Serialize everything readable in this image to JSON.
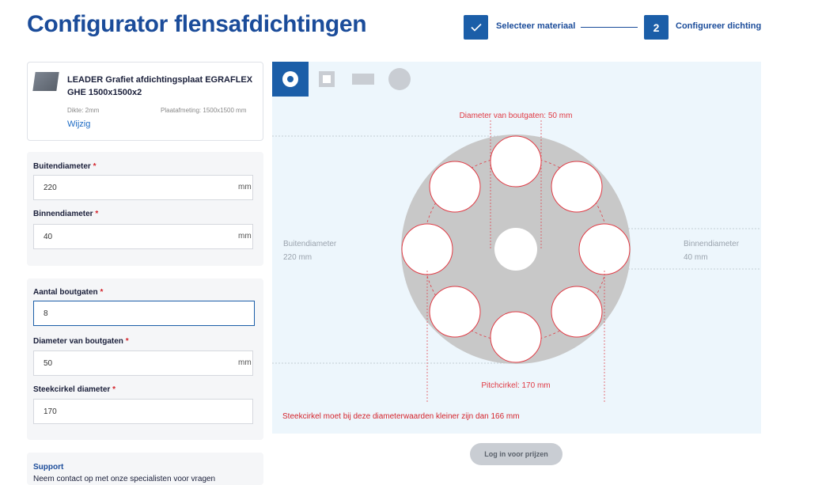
{
  "page": {
    "title": "Configurator flensafdichtingen"
  },
  "stepper": {
    "step1": {
      "label": "Selecteer materiaal",
      "icon": "checkmark-icon"
    },
    "step2": {
      "number": "2",
      "label": "Configureer dichting"
    }
  },
  "product": {
    "name": "LEADER Grafiet afdichtingsplaat EGRAFLEX GHE 1500x1500x2",
    "thickness": "Dikte: 2mm",
    "plate_size": "Plaatafmeting: 1500x1500 mm",
    "change_link": "Wijzig"
  },
  "form": {
    "outer_diameter": {
      "label": "Buitendiameter",
      "value": "220",
      "unit": "mm"
    },
    "inner_diameter": {
      "label": "Binnendiameter",
      "value": "40",
      "unit": "mm"
    },
    "bolt_hole_count": {
      "label": "Aantal boutgaten",
      "value": "8"
    },
    "bolt_hole_diameter": {
      "label": "Diameter van boutgaten",
      "value": "50",
      "unit": "mm"
    },
    "pitch_circle_diameter": {
      "label": "Steekcirkel diameter",
      "value": "170"
    },
    "required_marker": "*"
  },
  "support": {
    "title": "Support",
    "text": "Neem contact op met onze specialisten voor vragen"
  },
  "shape_tabs": [
    {
      "name": "ring-shape-icon",
      "active": true
    },
    {
      "name": "square-shape-icon",
      "active": false
    },
    {
      "name": "rectangle-shape-icon",
      "active": false
    },
    {
      "name": "disc-shape-icon",
      "active": false
    }
  ],
  "diagram": {
    "bolt_hole_label": "Diameter van boutgaten: 50 mm",
    "outer_label": "Buitendiameter",
    "outer_value": "220 mm",
    "inner_label": "Binnendiameter",
    "inner_value": "40 mm",
    "pitch_label": "Pitchcirkel: 170 mm",
    "warning": "Steekcirkel moet bij deze diameterwaarden kleiner zijn dan 166 mm"
  },
  "actions": {
    "login_prices": "Log in voor prijzen"
  },
  "colors": {
    "brand_blue": "#1b5ea8",
    "title_blue": "#1b4c9a",
    "error_red": "#d4242c",
    "gasket_gray": "#c8c8c8",
    "drawing_bg": "#edf6fc"
  }
}
